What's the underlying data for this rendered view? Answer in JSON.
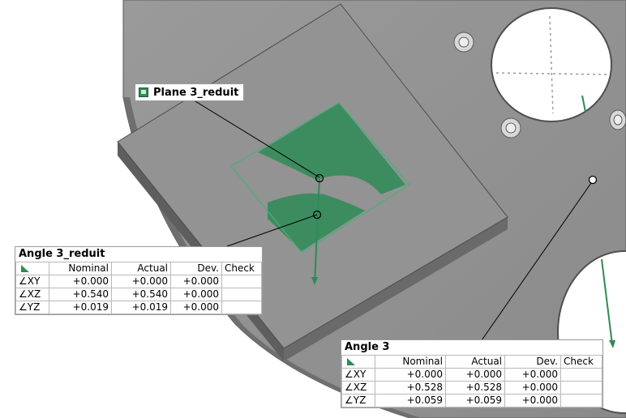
{
  "plane_label": {
    "text": "Plane 3_reduit",
    "icon": "plane-icon"
  },
  "angle_tables": [
    {
      "title": "Angle 3_reduit",
      "columns": [
        "Nominal",
        "Actual",
        "Dev.",
        "Check"
      ],
      "rows": [
        {
          "label": "∠XY",
          "nominal": "+0.000",
          "actual": "+0.000",
          "dev": "+0.000",
          "check": ""
        },
        {
          "label": "∠XZ",
          "nominal": "+0.540",
          "actual": "+0.540",
          "dev": "+0.000",
          "check": ""
        },
        {
          "label": "∠YZ",
          "nominal": "+0.019",
          "actual": "+0.019",
          "dev": "+0.000",
          "check": ""
        }
      ]
    },
    {
      "title": "Angle 3",
      "columns": [
        "Nominal",
        "Actual",
        "Dev.",
        "Check"
      ],
      "rows": [
        {
          "label": "∠XY",
          "nominal": "+0.000",
          "actual": "+0.000",
          "dev": "+0.000",
          "check": ""
        },
        {
          "label": "∠XZ",
          "nominal": "+0.528",
          "actual": "+0.528",
          "dev": "+0.000",
          "check": ""
        },
        {
          "label": "∠YZ",
          "nominal": "+0.059",
          "actual": "+0.059",
          "dev": "+0.000",
          "check": ""
        }
      ]
    }
  ],
  "colors": {
    "part_gray": "#8a8a8a",
    "measure_green": "#2e8b57",
    "background": "#ffffff"
  }
}
